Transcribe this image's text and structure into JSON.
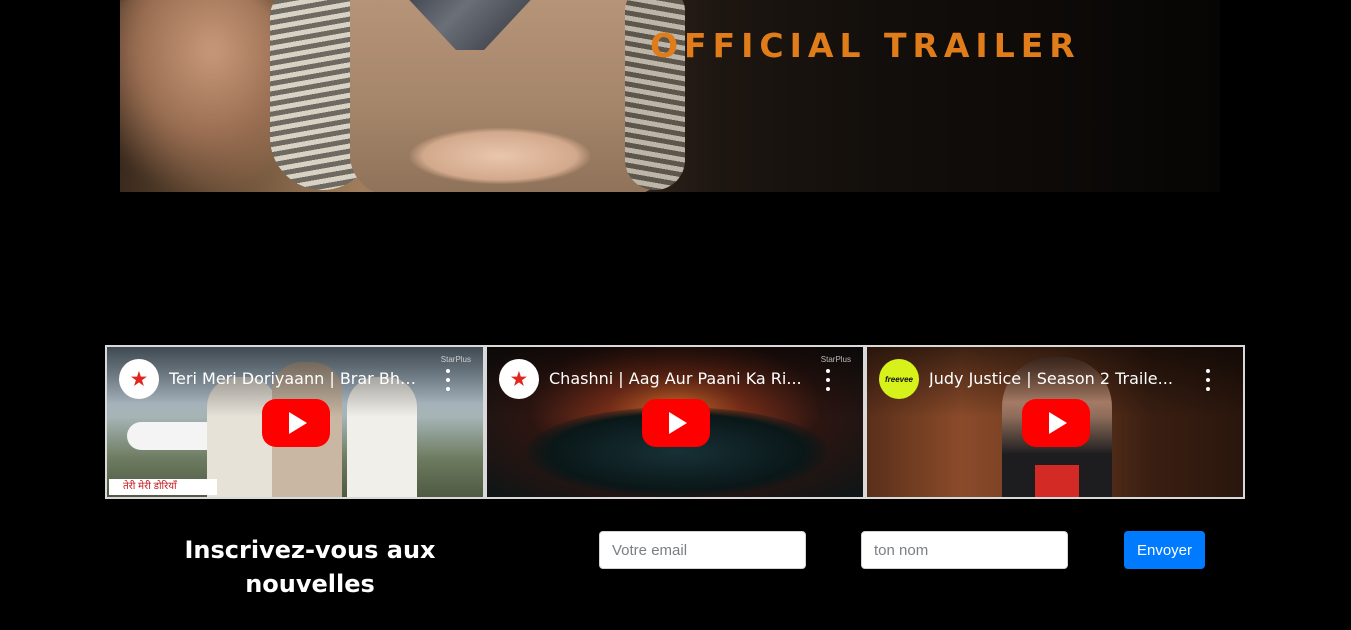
{
  "hero": {
    "title": "OFFICIAL TRAILER"
  },
  "videos": [
    {
      "title": "Teri Meri Doriyaann | Brar Bha...",
      "channel": "StarPlus",
      "watermark": "StarPlus",
      "lower_third": "तेरी मेरी डोरियाँ"
    },
    {
      "title": "Chashni | Aag Aur Paani Ka Ri...",
      "channel": "StarPlus",
      "watermark": "StarPlus"
    },
    {
      "title": "Judy Justice | Season 2 Traile...",
      "channel": "freevee"
    }
  ],
  "newsletter": {
    "title_line1": "Inscrivez-vous aux",
    "title_line2": "nouvelles",
    "email_placeholder": "Votre email",
    "name_placeholder": "ton nom",
    "submit_label": "Envoyer"
  },
  "colors": {
    "accent": "#e07d1a",
    "button": "#007bff",
    "youtube_red": "#ff0000"
  }
}
